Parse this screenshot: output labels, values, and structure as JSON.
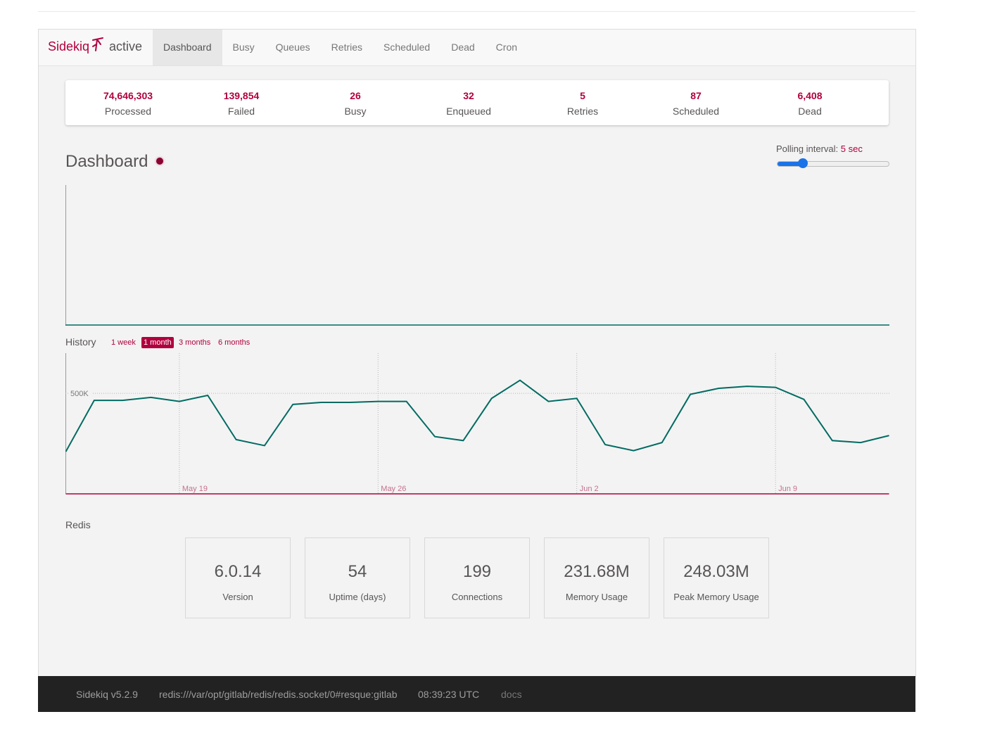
{
  "app": {
    "brand": "Sidekiq",
    "status": "active"
  },
  "nav": {
    "items": [
      "Dashboard",
      "Busy",
      "Queues",
      "Retries",
      "Scheduled",
      "Dead",
      "Cron"
    ],
    "active": "Dashboard"
  },
  "summary": [
    {
      "count": "74,646,303",
      "label": "Processed"
    },
    {
      "count": "139,854",
      "label": "Failed"
    },
    {
      "count": "26",
      "label": "Busy"
    },
    {
      "count": "32",
      "label": "Enqueued"
    },
    {
      "count": "5",
      "label": "Retries"
    },
    {
      "count": "87",
      "label": "Scheduled"
    },
    {
      "count": "6,408",
      "label": "Dead"
    }
  ],
  "dashboard": {
    "title": "Dashboard",
    "polling_label": "Polling interval:",
    "polling_value": "5 sec",
    "polling_fraction": 0.2
  },
  "history": {
    "label": "History",
    "ranges": [
      "1 week",
      "1 month",
      "3 months",
      "6 months"
    ],
    "active_range": "1 month"
  },
  "chart_data": {
    "type": "line",
    "x": [
      "May 15",
      "May 16",
      "May 17",
      "May 18",
      "May 19",
      "May 20",
      "May 21",
      "May 22",
      "May 23",
      "May 24",
      "May 25",
      "May 26",
      "May 27",
      "May 28",
      "May 29",
      "May 30",
      "May 31",
      "Jun 1",
      "Jun 2",
      "Jun 3",
      "Jun 4",
      "Jun 5",
      "Jun 6",
      "Jun 7",
      "Jun 8",
      "Jun 9",
      "Jun 10",
      "Jun 11",
      "Jun 12",
      "Jun 13"
    ],
    "x_ticks": [
      "May 19",
      "May 26",
      "Jun 2",
      "Jun 9"
    ],
    "y_ticks": [
      "500K"
    ],
    "series": [
      {
        "color": "#006b62",
        "values": [
          210000,
          465000,
          465000,
          480000,
          460000,
          490000,
          270000,
          240000,
          445000,
          455000,
          455000,
          460000,
          460000,
          285000,
          265000,
          475000,
          565000,
          460000,
          475000,
          245000,
          215000,
          255000,
          495000,
          525000,
          535000,
          530000,
          470000,
          265000,
          255000,
          290000
        ]
      },
      {
        "color": "#b1003e",
        "values": [
          0,
          0,
          0,
          0,
          0,
          0,
          0,
          0,
          0,
          0,
          0,
          0,
          0,
          0,
          0,
          0,
          0,
          0,
          0,
          0,
          0,
          0,
          0,
          0,
          0,
          0,
          0,
          0,
          0,
          0
        ]
      }
    ],
    "ylim": [
      0,
      700000
    ],
    "grid": true
  },
  "redis": {
    "title": "Redis",
    "stats": [
      {
        "value": "6.0.14",
        "label": "Version"
      },
      {
        "value": "54",
        "label": "Uptime (days)"
      },
      {
        "value": "199",
        "label": "Connections"
      },
      {
        "value": "231.68M",
        "label": "Memory Usage"
      },
      {
        "value": "248.03M",
        "label": "Peak Memory Usage"
      }
    ]
  },
  "footer": {
    "version": "Sidekiq v5.2.9",
    "redis_url": "redis:///var/opt/gitlab/redis/redis.socket/0#resque:gitlab",
    "time": "08:39:23 UTC",
    "docs": "docs"
  },
  "colors": {
    "accent": "#b1003e",
    "line": "#006b62",
    "footer_bg": "#222222",
    "slider": "#1a73e8"
  }
}
